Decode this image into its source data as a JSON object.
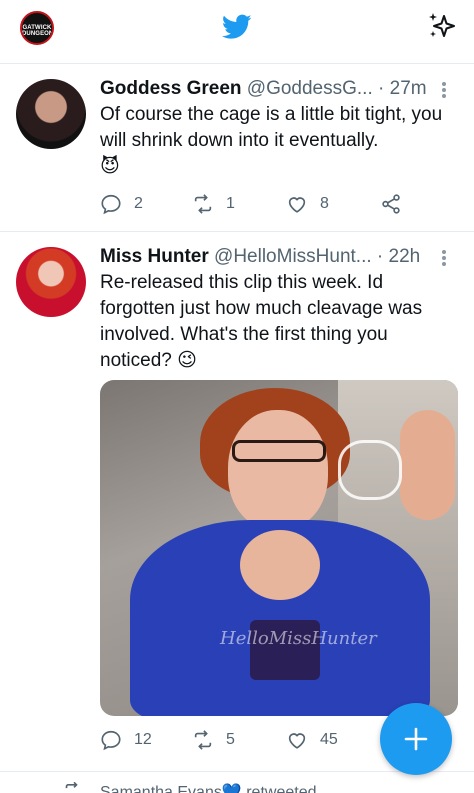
{
  "header": {
    "avatar_logo_line1": "GATWICK",
    "avatar_logo_line2": "DUNGEON"
  },
  "tweets": [
    {
      "name": "Goddess Green",
      "handle": "@GoddessG...",
      "time": "· 27m",
      "text": "Of course the cage is a little bit tight, you will shrink down into it eventually.",
      "emoji": "😈",
      "replies": "2",
      "retweets": "1",
      "likes": "8"
    },
    {
      "name": "Miss Hunter",
      "handle": "@HelloMissHunt...",
      "time": "· 22h",
      "text": "Re-released this clip this week. Id forgotten just how much cleavage was involved. What's the first thing you noticed?",
      "emoji": "😉",
      "media_watermark": "HelloMissHunter",
      "replies": "12",
      "retweets": "5",
      "likes": "45"
    }
  ],
  "next_tweet": {
    "retweet_context": "Samantha Evans💙 retweeted"
  },
  "colors": {
    "accent": "#1d9bf0",
    "text": "#0f1419",
    "secondary": "#536471",
    "divider": "#e6ecf0"
  },
  "icons": {
    "top_left": "profile-avatar",
    "top_center": "twitter-bird-icon",
    "top_right": "sparkle-icon",
    "reply": "reply-icon",
    "retweet": "retweet-icon",
    "like": "heart-icon",
    "share": "share-icon",
    "compose": "plus-icon"
  }
}
